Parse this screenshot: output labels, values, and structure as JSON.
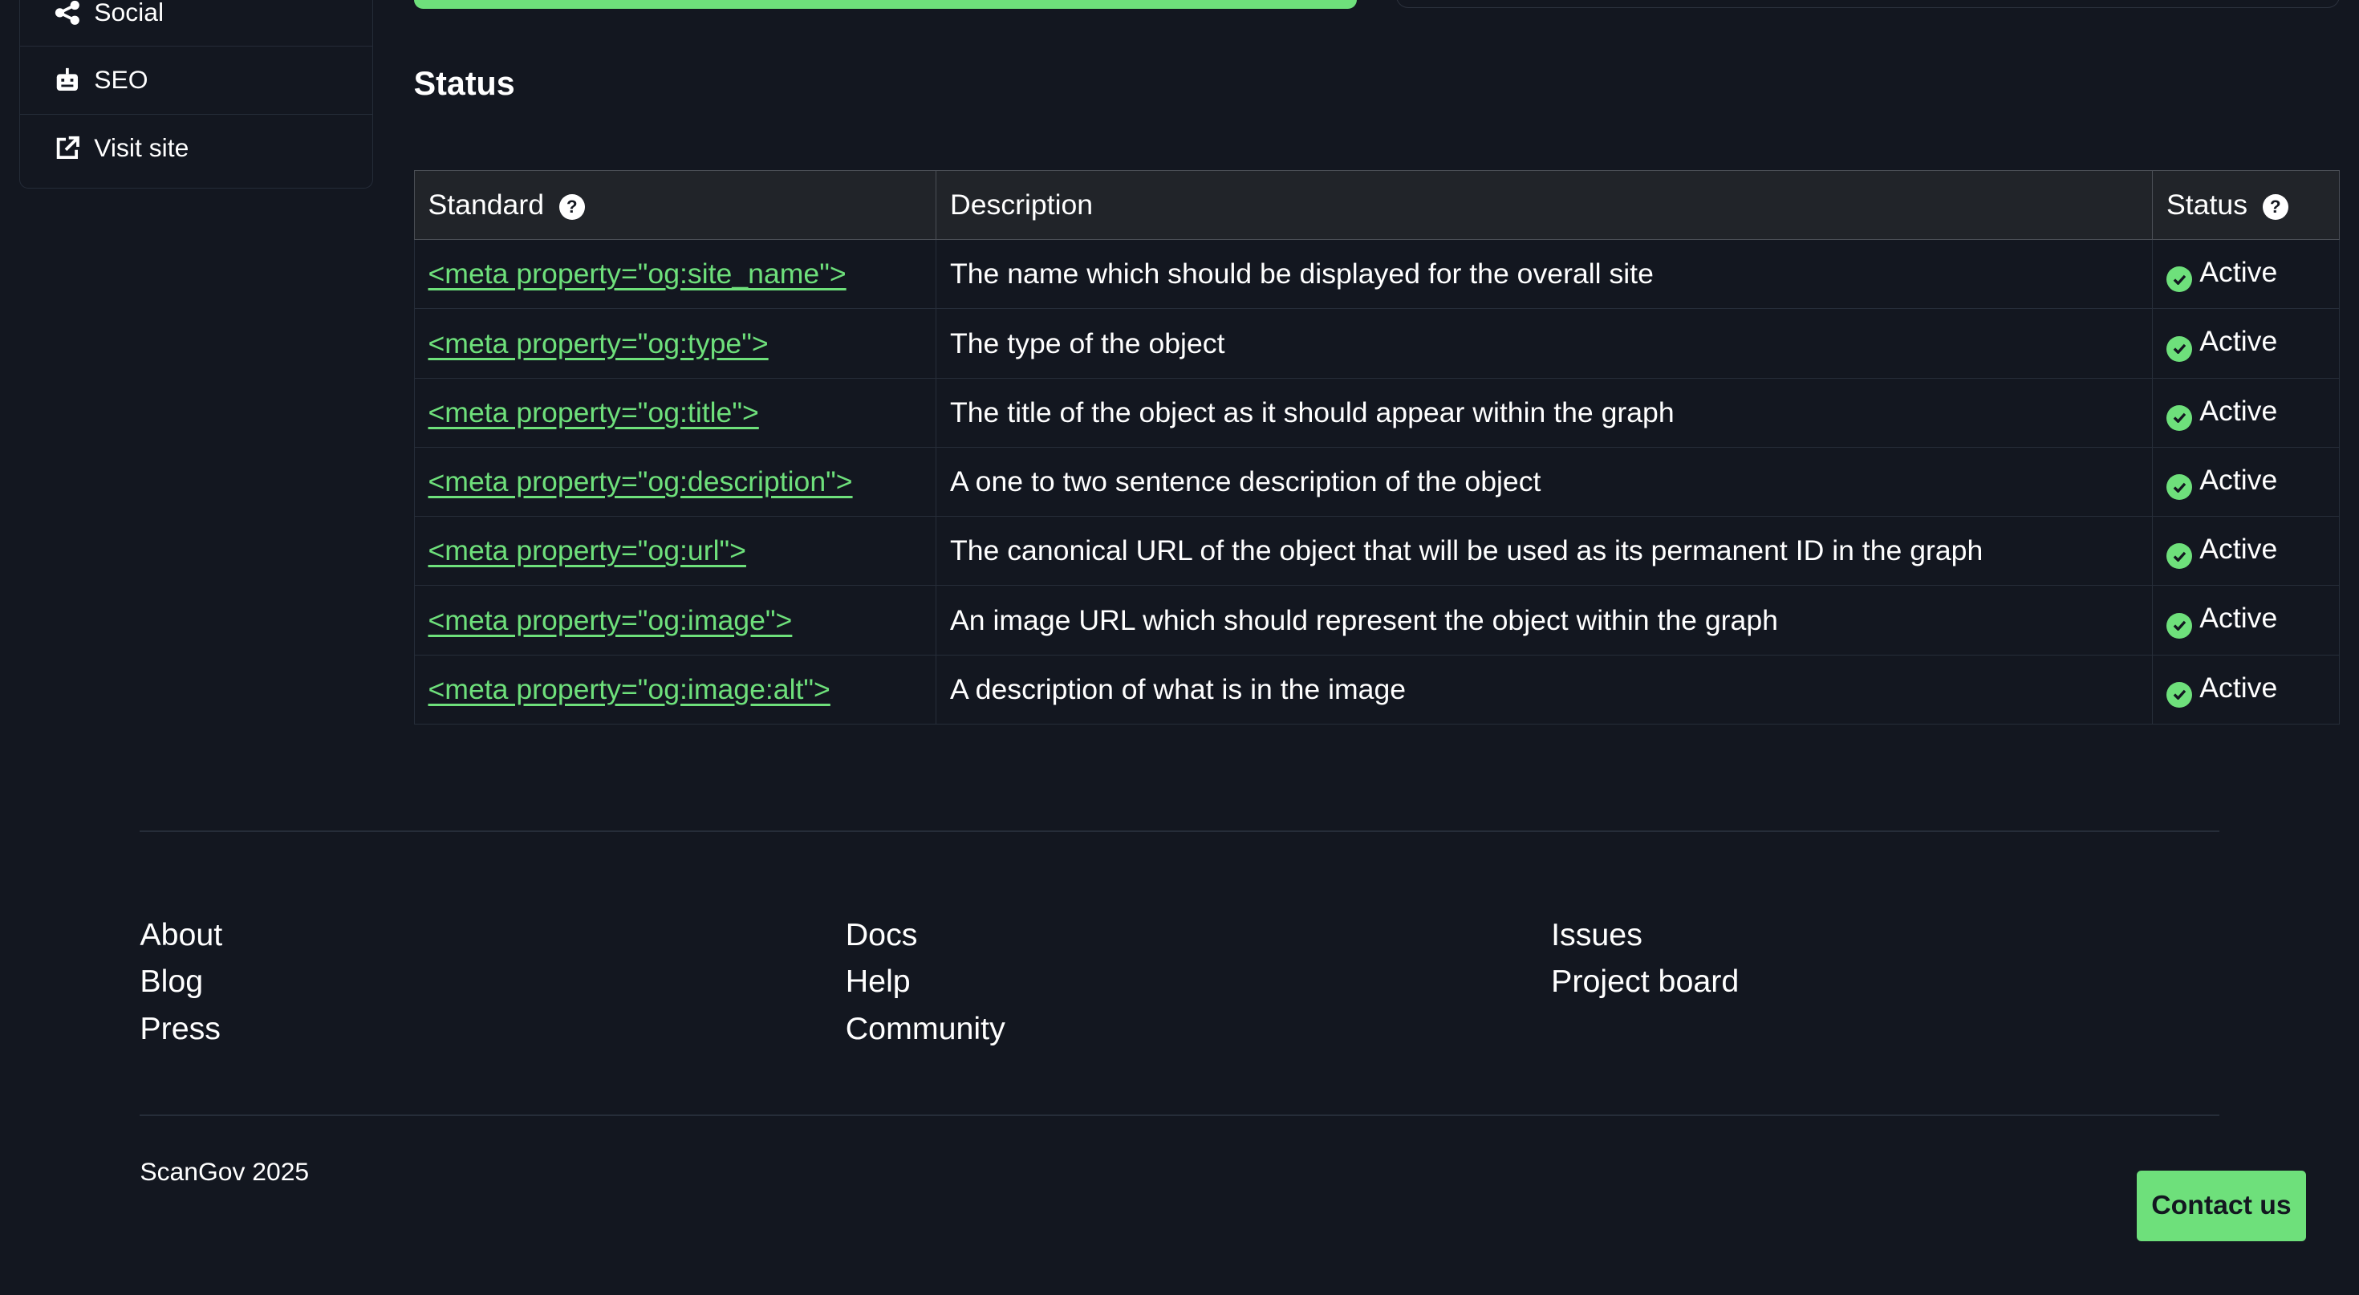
{
  "sidebar": {
    "items": [
      {
        "label": "Social",
        "icon": "share-icon"
      },
      {
        "label": "SEO",
        "icon": "robot-icon"
      },
      {
        "label": "Visit site",
        "icon": "external-link-icon"
      }
    ]
  },
  "section": {
    "title": "Status"
  },
  "table": {
    "headers": {
      "standard": "Standard",
      "description": "Description",
      "status": "Status"
    },
    "rows": [
      {
        "standard": "<meta property=\"og:site_name\">",
        "description": "The name which should be displayed for the overall site",
        "status": "Active"
      },
      {
        "standard": "<meta property=\"og:type\">",
        "description": "The type of the object",
        "status": "Active"
      },
      {
        "standard": "<meta property=\"og:title\">",
        "description": "The title of the object as it should appear within the graph",
        "status": "Active"
      },
      {
        "standard": "<meta property=\"og:description\">",
        "description": "A one to two sentence description of the object",
        "status": "Active"
      },
      {
        "standard": "<meta property=\"og:url\">",
        "description": "The canonical URL of the object that will be used as its permanent ID in the graph",
        "status": "Active"
      },
      {
        "standard": "<meta property=\"og:image\">",
        "description": "An image URL which should represent the object within the graph",
        "status": "Active"
      },
      {
        "standard": "<meta property=\"og:image:alt\">",
        "description": "A description of what is in the image",
        "status": "Active"
      }
    ]
  },
  "footer": {
    "columns": [
      [
        "About",
        "Blog",
        "Press"
      ],
      [
        "Docs",
        "Help",
        "Community"
      ],
      [
        "Issues",
        "Project board"
      ]
    ],
    "copyright": "ScanGov 2025",
    "contact_label": "Contact us"
  },
  "colors": {
    "accent": "#6ee07b",
    "background": "#131720"
  }
}
